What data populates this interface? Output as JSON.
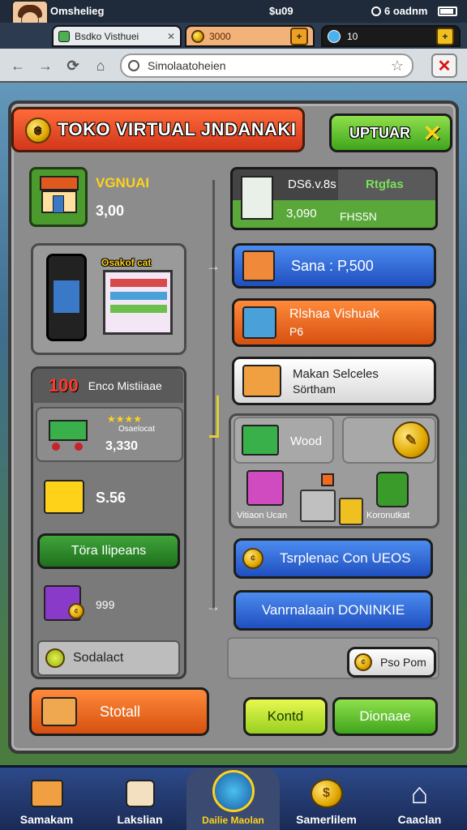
{
  "topbar": {
    "left_text": "Omshelieg",
    "center_text": "$u09",
    "right_text": "6 oadnm"
  },
  "tabs": [
    {
      "label": "Bsdko Visthuei"
    },
    {
      "label": "3000"
    },
    {
      "label": "10"
    }
  ],
  "nav": {
    "url": "Simolaatoheien"
  },
  "title": {
    "text": "TOKO VIRTUAL JNDANAKI",
    "update_label": "UPTUAR"
  },
  "left": {
    "store_label": "VGNUAI",
    "store_value": "3,00",
    "device_label": "Osakof cat",
    "list_header_number": "100",
    "list_header_text": "Enco Mistiiaae",
    "cart_stars": "★★★★",
    "cart_label": "Osaelocat",
    "cart_value": "3,330",
    "item_value": "S.56",
    "green_button": "Töra Ilipeans",
    "trolley_value": "999",
    "search_label": "Sodalact",
    "bottom_button": "Stotall"
  },
  "right": {
    "top_card_title": "DS6.v.8s",
    "top_card_highlight": "Rtgfas",
    "top_card_value": "3,090",
    "top_card_sub": "FHS5N",
    "blue_card": "Sana : P,500",
    "orange_card_title": "Rlshaa Vishuak",
    "orange_card_sub": "P6",
    "white_card_title": "Makan Selceles",
    "white_card_sub": "Sörtham",
    "grid_label": "Wood",
    "grid_item_left": "Vitiaon Ucan",
    "grid_item_right": "Koronutkat",
    "blue_btn_1": "Tsrplenac Con UEOS",
    "blue_btn_2": "Vanrnalaain DONINKIE",
    "small_btn": "Pso Pom",
    "btn_kontd": "Kontd",
    "btn_dionaae": "Dionaae"
  },
  "bottom_nav": [
    {
      "label": "Samakam",
      "icon": "shop-icon"
    },
    {
      "label": "Lakslian",
      "icon": "sack-icon"
    },
    {
      "label": "Dailie Maolan",
      "icon": "globe-icon"
    },
    {
      "label": "Samerlilem",
      "icon": "coins-icon"
    },
    {
      "label": "Caaclan",
      "icon": "home-icon"
    }
  ],
  "colors": {
    "accent_red": "#d1361a",
    "accent_green": "#3fa51c",
    "accent_blue": "#1f4fbf",
    "panel": "#8c8c8c"
  }
}
